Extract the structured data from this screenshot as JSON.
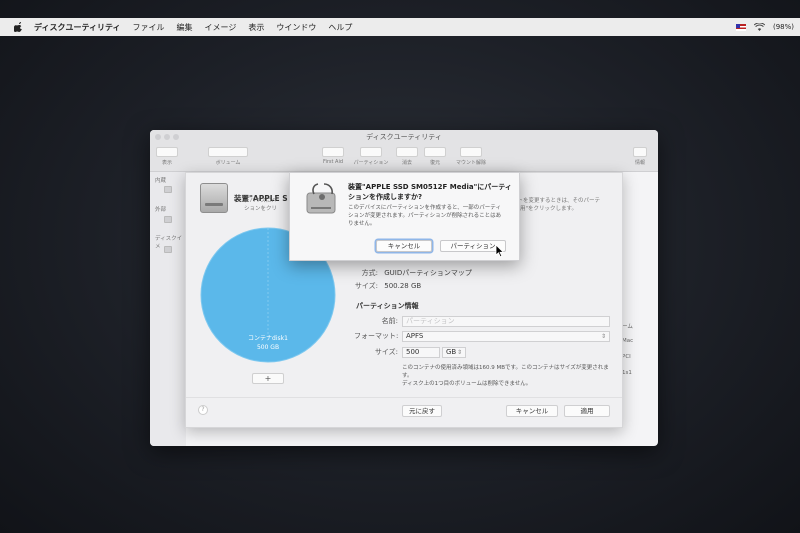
{
  "menubar": {
    "app": "ディスクユーティリティ",
    "items": [
      "ファイル",
      "編集",
      "イメージ",
      "表示",
      "ウインドウ",
      "ヘルプ"
    ],
    "battery": "(98%)"
  },
  "window": {
    "title": "ディスクユーティリティ",
    "toolbar": [
      "表示",
      "ボリューム",
      "First Aid",
      "パーティション",
      "消去",
      "復元",
      "マウント解除",
      "情報"
    ],
    "sidebar": {
      "internal": "内蔵",
      "external": "外部",
      "disk_images": "ディスクイメ"
    },
    "right_pane": [
      "ーム",
      "Mac",
      "PCI",
      "1s1"
    ]
  },
  "sheet": {
    "title": "装置\"APPLE S",
    "description_left": [
      "デバイスにパーテ",
      "ションをクリック"
    ],
    "description_right": [
      "ットを変更するときは、そのパーテ",
      "\"適用\"をクリックします。"
    ],
    "pie_label": "コンテナdisk1",
    "pie_size": "500 GB",
    "plus_label": "+",
    "scheme_label": "方式:",
    "scheme_value": "GUIDパーティションマップ",
    "size_label": "サイズ:",
    "size_value": "500.28 GB",
    "partition_info_title": "パーティション情報",
    "name_label": "名前:",
    "name_placeholder": "パーティション",
    "format_label": "フォーマット:",
    "format_value": "APFS",
    "psize_label": "サイズ:",
    "psize_value": "500",
    "unit_value": "GB",
    "note_lines": [
      "このコンテナの使用済み領域は160.9 MBです。このコンテナはサイズが変更されま",
      "す。",
      "ディスク上の1つ目のボリュームは削除できません。"
    ],
    "help": "?",
    "revert": "元に戻す",
    "cancel": "キャンセル",
    "apply": "適用"
  },
  "alert": {
    "title_line1": "装置\"APPLE SSD SM0512F Media\"にパーティ",
    "title_line2": "ションを作成しますか?",
    "message_lines": [
      "このデバイスにパーティションを作成すると、一部のパーティ",
      "ションが変更されます。パーティションが削除されることはあ",
      "りません。"
    ],
    "cancel": "キャンセル",
    "partition": "パーティション"
  }
}
